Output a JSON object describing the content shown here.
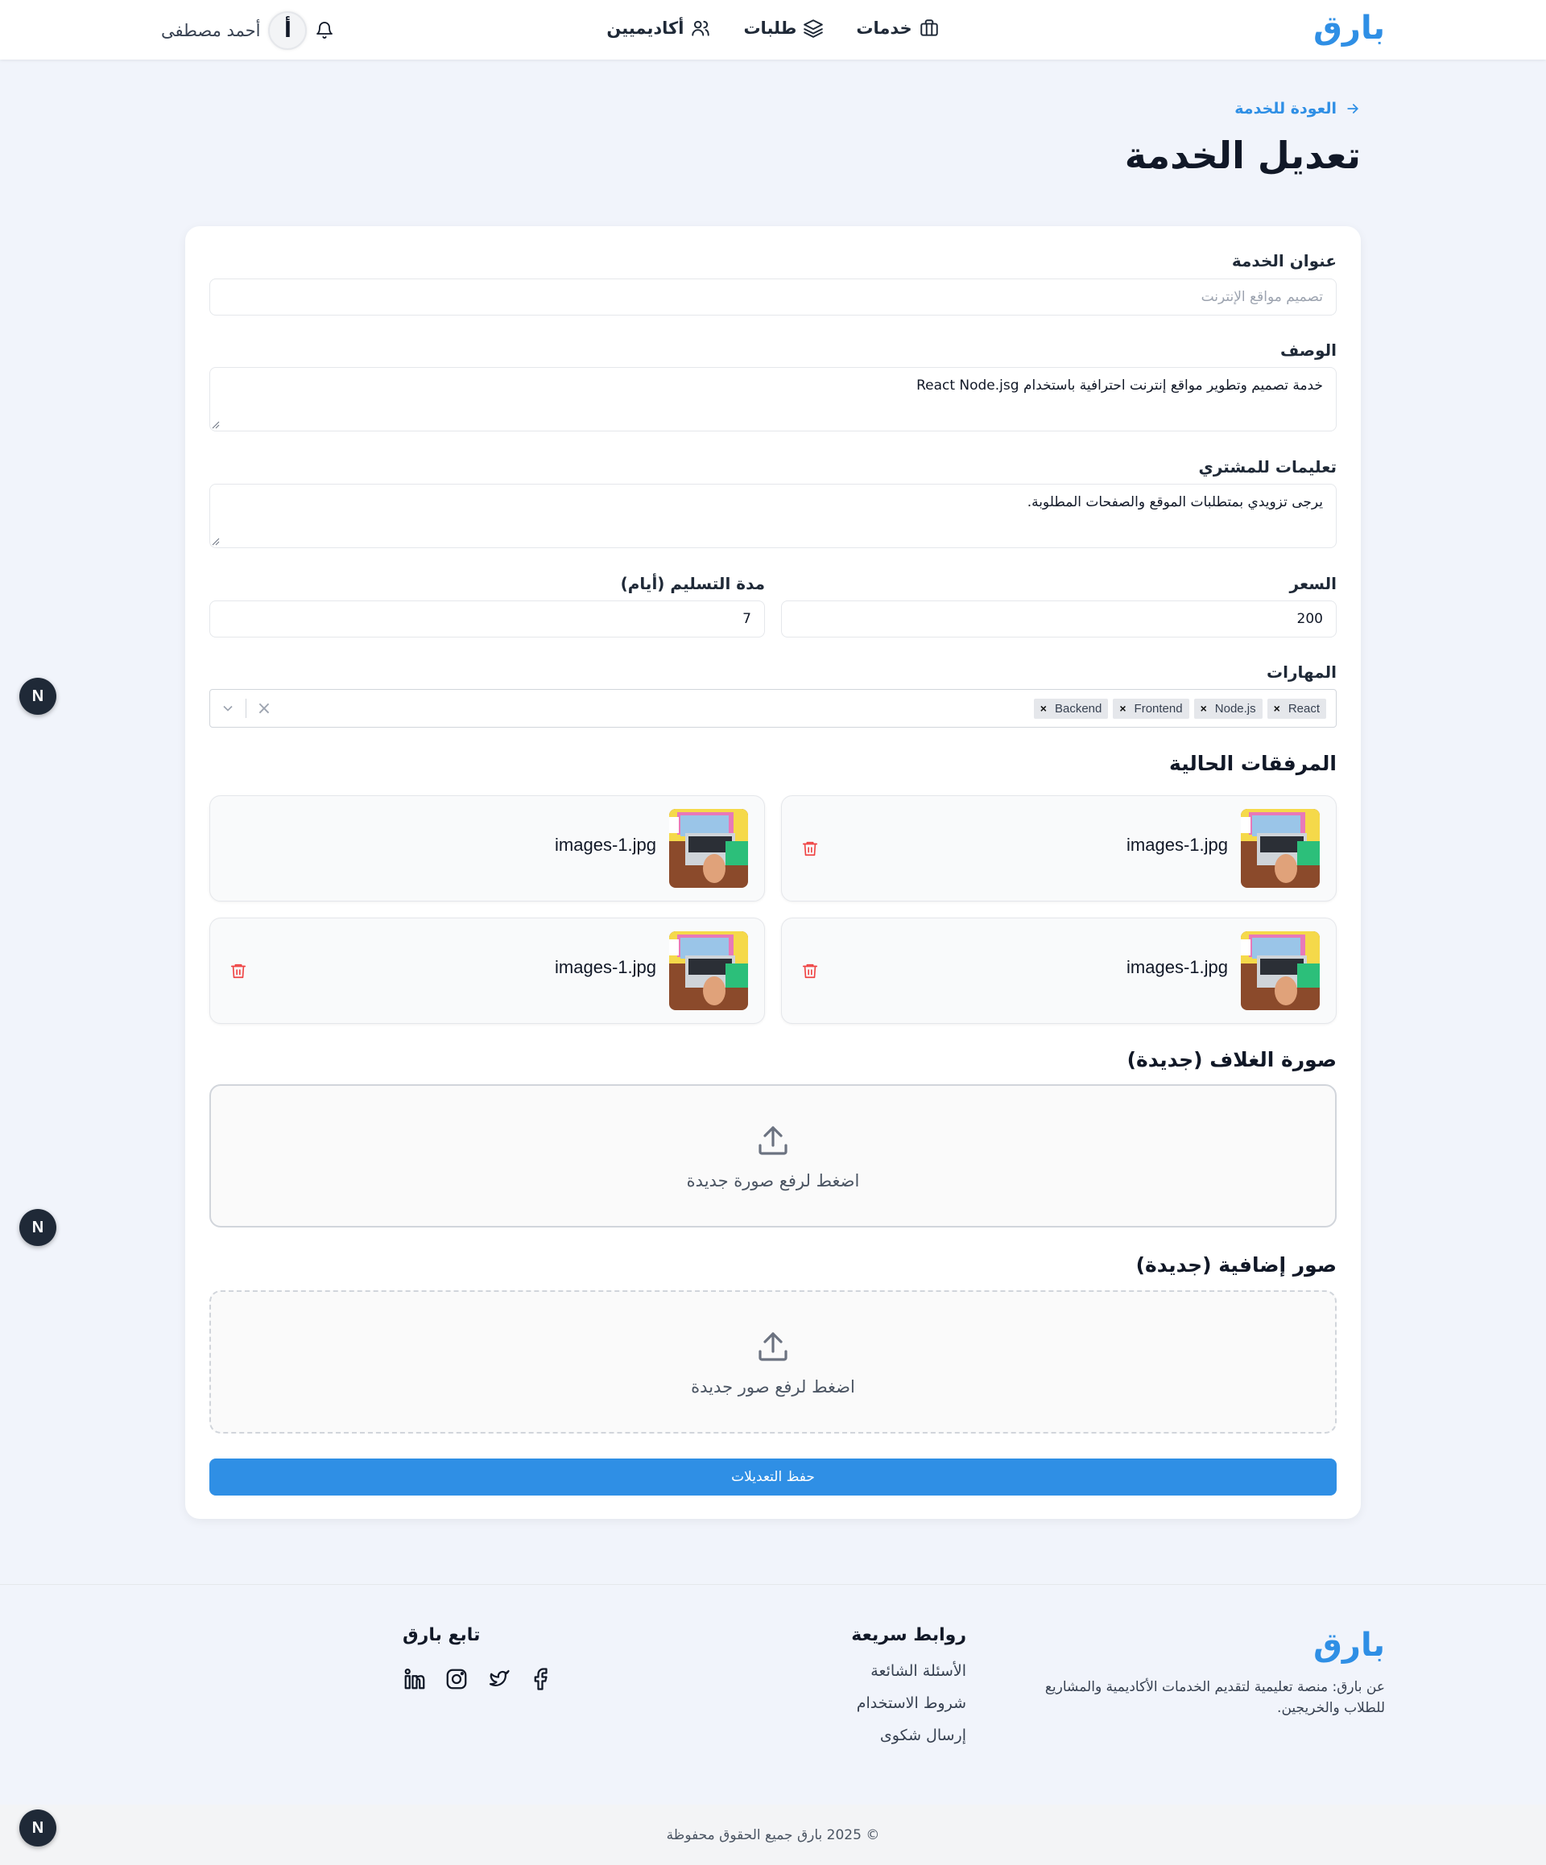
{
  "header": {
    "logo": "بارق",
    "nav": [
      {
        "label": "خدمات",
        "icon": "briefcase-icon"
      },
      {
        "label": "طلبات",
        "icon": "layers-icon"
      },
      {
        "label": "أكاديميين",
        "icon": "users-icon"
      }
    ],
    "user_name": "أحمد مصطفى",
    "avatar_letter": "أ"
  },
  "page": {
    "back_label": "العودة للخدمة",
    "title": "تعديل الخدمة"
  },
  "form": {
    "title_label": "عنوان الخدمة",
    "title_placeholder": "تصميم مواقع الإنترنت",
    "description_label": "الوصف",
    "description_value": "خدمة تصميم وتطوير مواقع إنترنت احترافية باستخدام React Node.jsg",
    "instructions_label": "تعليمات للمشتري",
    "instructions_value": "يرجى تزويدي بمتطلبات الموقع والصفحات المطلوبة.",
    "price_label": "السعر",
    "price_value": "200",
    "delivery_label": "مدة التسليم (أيام)",
    "delivery_value": "7",
    "skills_label": "المهارات",
    "skills": [
      "React",
      "Node.js",
      "Frontend",
      "Backend"
    ]
  },
  "attachments": {
    "title": "المرفقات الحالية",
    "items": [
      {
        "name": "images-1.jpg",
        "deletable": true
      },
      {
        "name": "images-1.jpg",
        "deletable": false
      },
      {
        "name": "images-1.jpg",
        "deletable": true
      },
      {
        "name": "images-1.jpg",
        "deletable": true
      }
    ]
  },
  "cover": {
    "title": "صورة الغلاف (جديدة)",
    "upload_text": "اضغط لرفع صورة جديدة"
  },
  "extra": {
    "title": "صور إضافية (جديدة)",
    "upload_text": "اضغط لرفع صور جديدة"
  },
  "save_label": "حفظ التعديلات",
  "badge_letter": "N",
  "footer": {
    "logo": "بارق",
    "about": "عن بارق: منصة تعليمية لتقديم الخدمات الأكاديمية والمشاريع للطلاب والخريجين.",
    "quick_links_title": "روابط سريعة",
    "quick_links": [
      "الأسئلة الشائعة",
      "شروط الاستخدام",
      "إرسال شكوى"
    ],
    "follow_title": "تابع بارق",
    "socials": [
      "facebook-icon",
      "twitter-icon",
      "instagram-icon",
      "linkedin-icon"
    ],
    "copyright": "© 2025 بارق جميع الحقوق محفوظة"
  },
  "colors": {
    "brand": "#2f8fe5",
    "danger": "#ef4444",
    "background": "#f1f4fb"
  }
}
